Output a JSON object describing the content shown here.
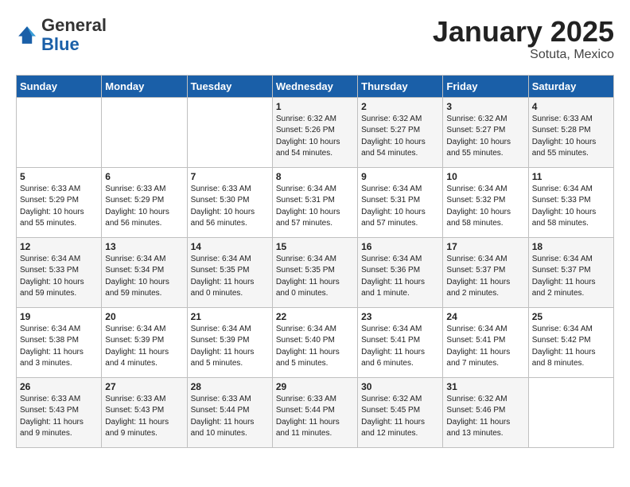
{
  "logo": {
    "general": "General",
    "blue": "Blue"
  },
  "title": "January 2025",
  "subtitle": "Sotuta, Mexico",
  "days_of_week": [
    "Sunday",
    "Monday",
    "Tuesday",
    "Wednesday",
    "Thursday",
    "Friday",
    "Saturday"
  ],
  "weeks": [
    [
      {
        "day": "",
        "sunrise": "",
        "sunset": "",
        "daylight": "",
        "empty": true
      },
      {
        "day": "",
        "sunrise": "",
        "sunset": "",
        "daylight": "",
        "empty": true
      },
      {
        "day": "",
        "sunrise": "",
        "sunset": "",
        "daylight": "",
        "empty": true
      },
      {
        "day": "1",
        "sunrise": "Sunrise: 6:32 AM",
        "sunset": "Sunset: 5:26 PM",
        "daylight": "Daylight: 10 hours and 54 minutes."
      },
      {
        "day": "2",
        "sunrise": "Sunrise: 6:32 AM",
        "sunset": "Sunset: 5:27 PM",
        "daylight": "Daylight: 10 hours and 54 minutes."
      },
      {
        "day": "3",
        "sunrise": "Sunrise: 6:32 AM",
        "sunset": "Sunset: 5:27 PM",
        "daylight": "Daylight: 10 hours and 55 minutes."
      },
      {
        "day": "4",
        "sunrise": "Sunrise: 6:33 AM",
        "sunset": "Sunset: 5:28 PM",
        "daylight": "Daylight: 10 hours and 55 minutes."
      }
    ],
    [
      {
        "day": "5",
        "sunrise": "Sunrise: 6:33 AM",
        "sunset": "Sunset: 5:29 PM",
        "daylight": "Daylight: 10 hours and 55 minutes."
      },
      {
        "day": "6",
        "sunrise": "Sunrise: 6:33 AM",
        "sunset": "Sunset: 5:29 PM",
        "daylight": "Daylight: 10 hours and 56 minutes."
      },
      {
        "day": "7",
        "sunrise": "Sunrise: 6:33 AM",
        "sunset": "Sunset: 5:30 PM",
        "daylight": "Daylight: 10 hours and 56 minutes."
      },
      {
        "day": "8",
        "sunrise": "Sunrise: 6:34 AM",
        "sunset": "Sunset: 5:31 PM",
        "daylight": "Daylight: 10 hours and 57 minutes."
      },
      {
        "day": "9",
        "sunrise": "Sunrise: 6:34 AM",
        "sunset": "Sunset: 5:31 PM",
        "daylight": "Daylight: 10 hours and 57 minutes."
      },
      {
        "day": "10",
        "sunrise": "Sunrise: 6:34 AM",
        "sunset": "Sunset: 5:32 PM",
        "daylight": "Daylight: 10 hours and 58 minutes."
      },
      {
        "day": "11",
        "sunrise": "Sunrise: 6:34 AM",
        "sunset": "Sunset: 5:33 PM",
        "daylight": "Daylight: 10 hours and 58 minutes."
      }
    ],
    [
      {
        "day": "12",
        "sunrise": "Sunrise: 6:34 AM",
        "sunset": "Sunset: 5:33 PM",
        "daylight": "Daylight: 10 hours and 59 minutes."
      },
      {
        "day": "13",
        "sunrise": "Sunrise: 6:34 AM",
        "sunset": "Sunset: 5:34 PM",
        "daylight": "Daylight: 10 hours and 59 minutes."
      },
      {
        "day": "14",
        "sunrise": "Sunrise: 6:34 AM",
        "sunset": "Sunset: 5:35 PM",
        "daylight": "Daylight: 11 hours and 0 minutes."
      },
      {
        "day": "15",
        "sunrise": "Sunrise: 6:34 AM",
        "sunset": "Sunset: 5:35 PM",
        "daylight": "Daylight: 11 hours and 0 minutes."
      },
      {
        "day": "16",
        "sunrise": "Sunrise: 6:34 AM",
        "sunset": "Sunset: 5:36 PM",
        "daylight": "Daylight: 11 hours and 1 minute."
      },
      {
        "day": "17",
        "sunrise": "Sunrise: 6:34 AM",
        "sunset": "Sunset: 5:37 PM",
        "daylight": "Daylight: 11 hours and 2 minutes."
      },
      {
        "day": "18",
        "sunrise": "Sunrise: 6:34 AM",
        "sunset": "Sunset: 5:37 PM",
        "daylight": "Daylight: 11 hours and 2 minutes."
      }
    ],
    [
      {
        "day": "19",
        "sunrise": "Sunrise: 6:34 AM",
        "sunset": "Sunset: 5:38 PM",
        "daylight": "Daylight: 11 hours and 3 minutes."
      },
      {
        "day": "20",
        "sunrise": "Sunrise: 6:34 AM",
        "sunset": "Sunset: 5:39 PM",
        "daylight": "Daylight: 11 hours and 4 minutes."
      },
      {
        "day": "21",
        "sunrise": "Sunrise: 6:34 AM",
        "sunset": "Sunset: 5:39 PM",
        "daylight": "Daylight: 11 hours and 5 minutes."
      },
      {
        "day": "22",
        "sunrise": "Sunrise: 6:34 AM",
        "sunset": "Sunset: 5:40 PM",
        "daylight": "Daylight: 11 hours and 5 minutes."
      },
      {
        "day": "23",
        "sunrise": "Sunrise: 6:34 AM",
        "sunset": "Sunset: 5:41 PM",
        "daylight": "Daylight: 11 hours and 6 minutes."
      },
      {
        "day": "24",
        "sunrise": "Sunrise: 6:34 AM",
        "sunset": "Sunset: 5:41 PM",
        "daylight": "Daylight: 11 hours and 7 minutes."
      },
      {
        "day": "25",
        "sunrise": "Sunrise: 6:34 AM",
        "sunset": "Sunset: 5:42 PM",
        "daylight": "Daylight: 11 hours and 8 minutes."
      }
    ],
    [
      {
        "day": "26",
        "sunrise": "Sunrise: 6:33 AM",
        "sunset": "Sunset: 5:43 PM",
        "daylight": "Daylight: 11 hours and 9 minutes."
      },
      {
        "day": "27",
        "sunrise": "Sunrise: 6:33 AM",
        "sunset": "Sunset: 5:43 PM",
        "daylight": "Daylight: 11 hours and 9 minutes."
      },
      {
        "day": "28",
        "sunrise": "Sunrise: 6:33 AM",
        "sunset": "Sunset: 5:44 PM",
        "daylight": "Daylight: 11 hours and 10 minutes."
      },
      {
        "day": "29",
        "sunrise": "Sunrise: 6:33 AM",
        "sunset": "Sunset: 5:44 PM",
        "daylight": "Daylight: 11 hours and 11 minutes."
      },
      {
        "day": "30",
        "sunrise": "Sunrise: 6:32 AM",
        "sunset": "Sunset: 5:45 PM",
        "daylight": "Daylight: 11 hours and 12 minutes."
      },
      {
        "day": "31",
        "sunrise": "Sunrise: 6:32 AM",
        "sunset": "Sunset: 5:46 PM",
        "daylight": "Daylight: 11 hours and 13 minutes."
      },
      {
        "day": "",
        "sunrise": "",
        "sunset": "",
        "daylight": "",
        "empty": true
      }
    ]
  ]
}
